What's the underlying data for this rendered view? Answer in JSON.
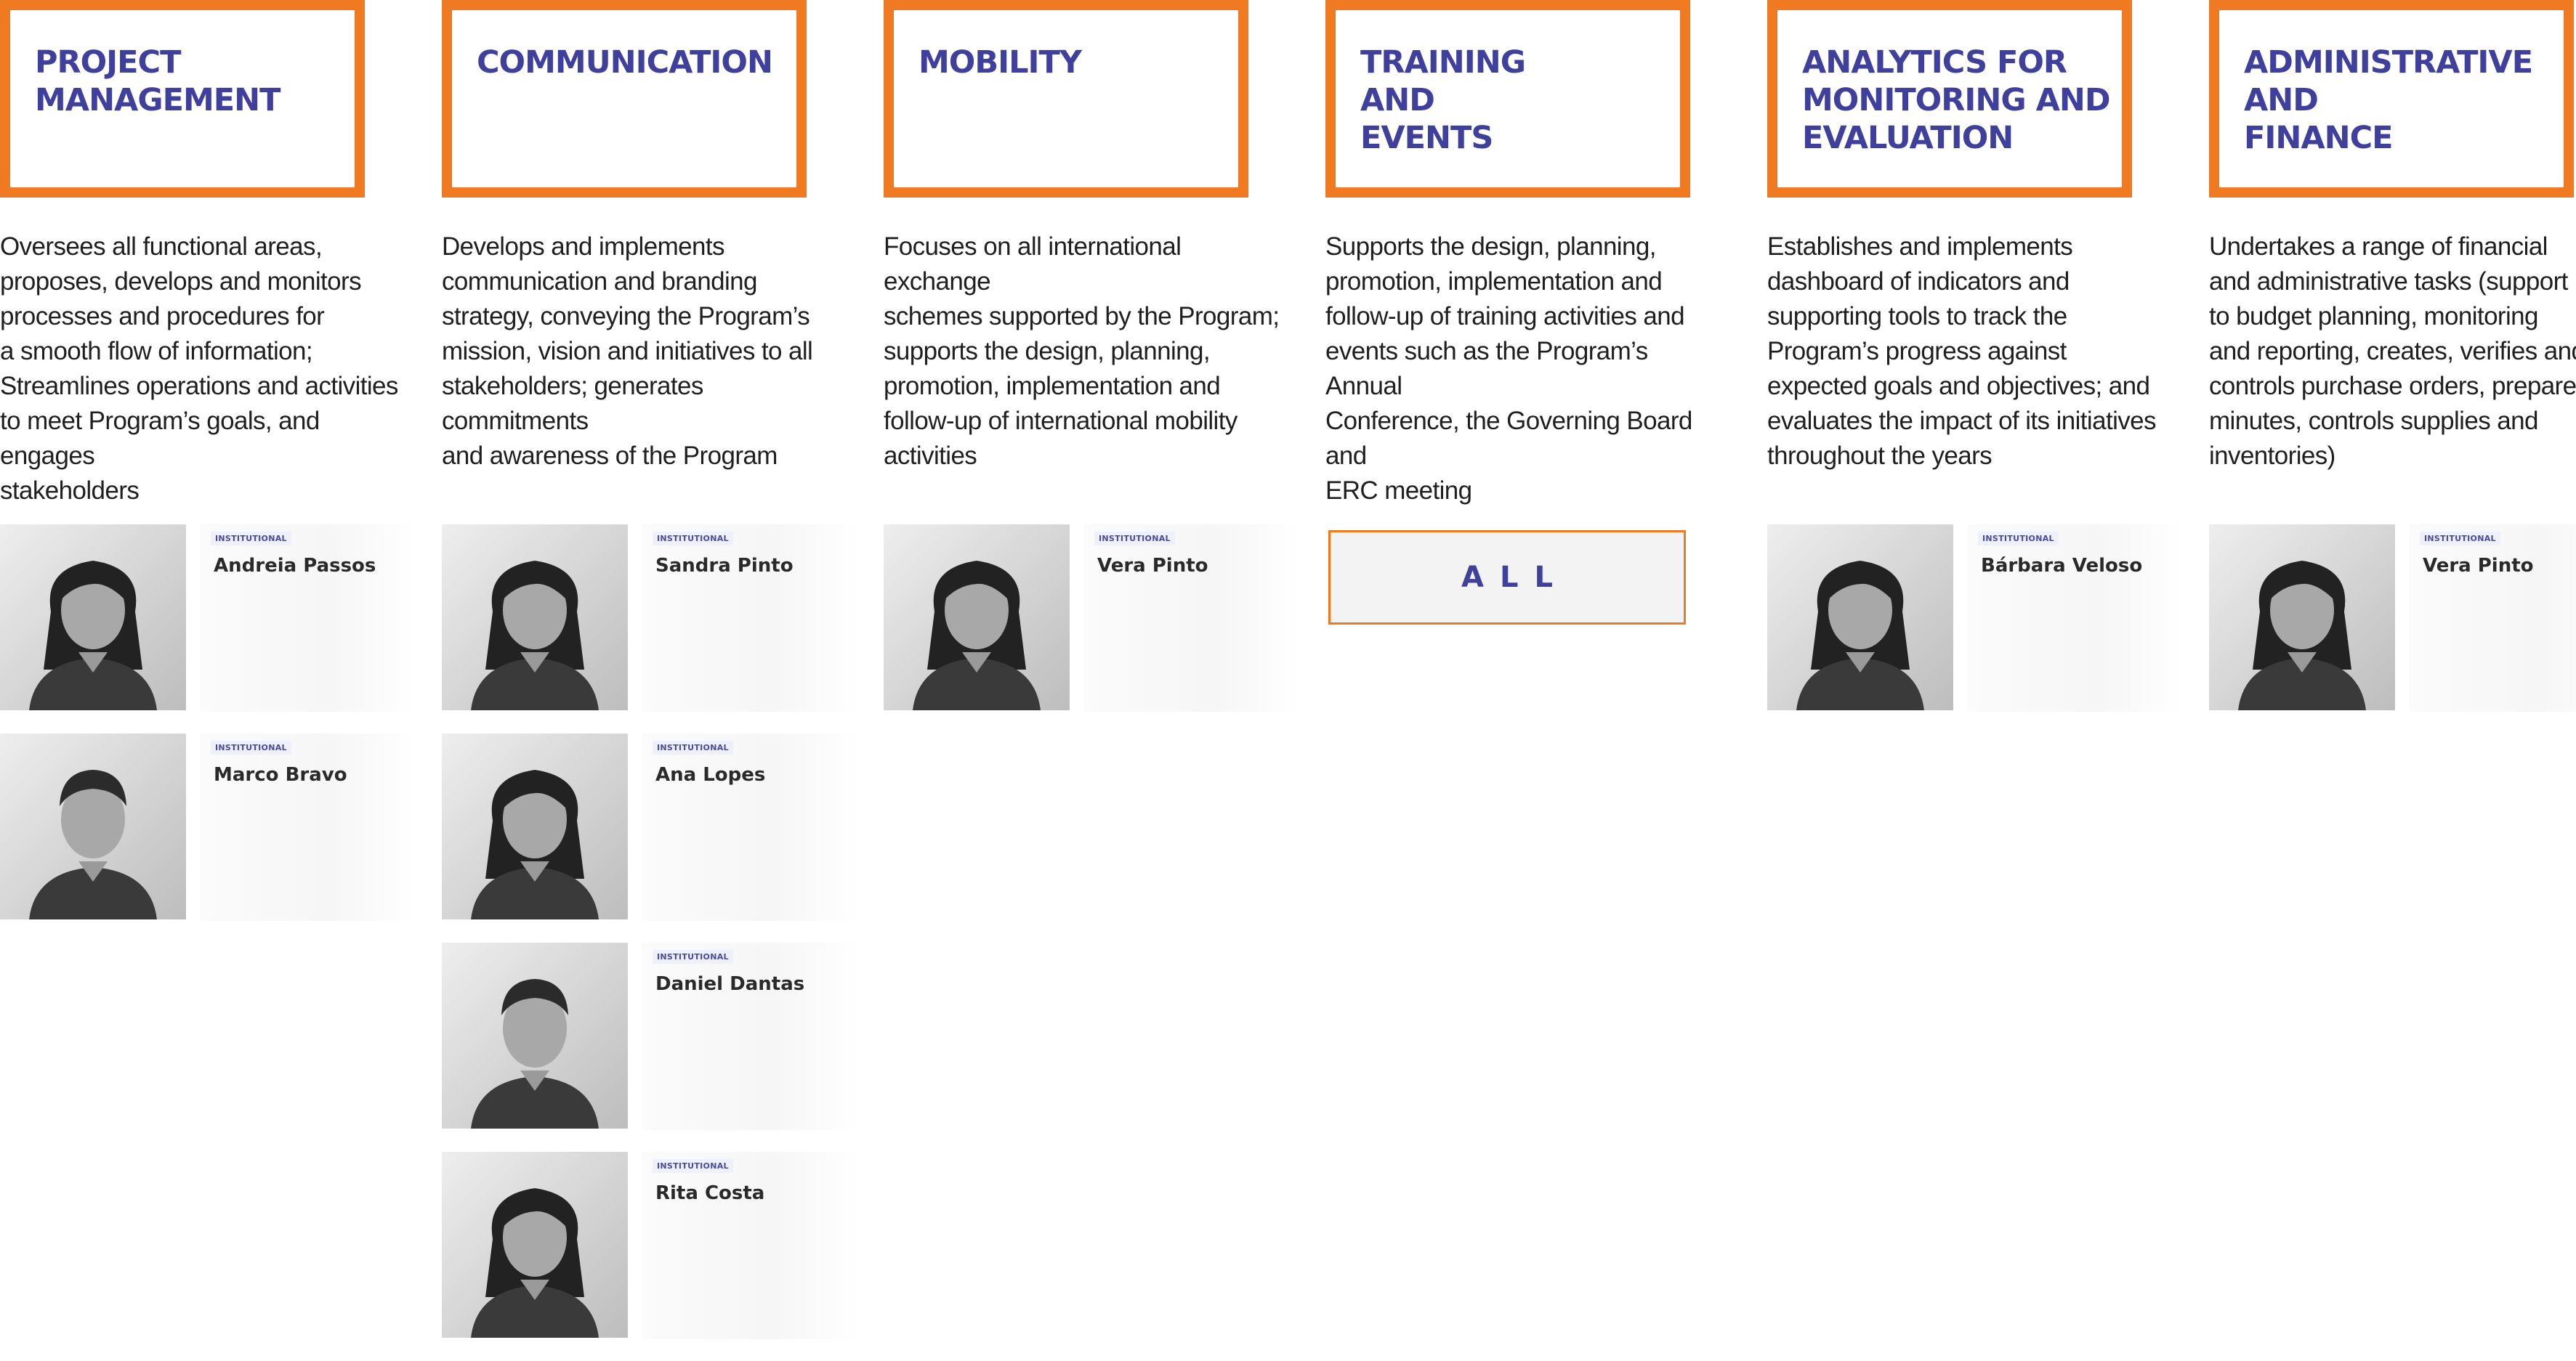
{
  "areas": [
    {
      "title": "PROJECT\nMANAGEMENT",
      "description": "Oversees all functional areas, proposes, develops and monitors processes and procedures for a smooth flow of information; Streamlines operations and activities to meet Program’s goals, and engages stakeholders",
      "members": [
        {
          "tag": "INSTITUTIONAL",
          "name": "Andreia Passos",
          "photo_icon": "portrait-woman"
        },
        {
          "tag": "INSTITUTIONAL",
          "name": "Marco Bravo",
          "photo_icon": "portrait-man"
        }
      ]
    },
    {
      "title": "COMMUNICATION",
      "description": "Develops and implements communication and branding strategy, conveying the Program’s mission, vision and initiatives to all stakeholders; generates commitments and awareness of the Program",
      "members": [
        {
          "tag": "INSTITUTIONAL",
          "name": "Sandra Pinto",
          "photo_icon": "portrait-woman"
        },
        {
          "tag": "INSTITUTIONAL",
          "name": "Ana Lopes",
          "photo_icon": "portrait-woman"
        },
        {
          "tag": "INSTITUTIONAL",
          "name": "Daniel Dantas",
          "photo_icon": "portrait-man"
        },
        {
          "tag": "INSTITUTIONAL",
          "name": "Rita Costa",
          "photo_icon": "portrait-woman"
        }
      ]
    },
    {
      "title": "MOBILITY",
      "description": "Focuses on all international exchange schemes supported by the Program; supports the design, planning, promotion, implementation and follow-up of international mobility activities",
      "members": [
        {
          "tag": "INSTITUTIONAL",
          "name": "Vera Pinto",
          "photo_icon": "portrait-woman"
        }
      ]
    },
    {
      "title": "TRAINING\nAND\nEVENTS",
      "description": "Supports the design, planning, promotion, implementation and follow-up of training activities and events such as the Program’s Annual Conference, the Governing Board and ERC meeting",
      "members": [],
      "all_button": "ALL"
    },
    {
      "title": "ANALYTICS FOR\nMONITORING AND\nEVALUATION",
      "description": "Establishes and implements dashboard of indicators and supporting tools to track the Program’s progress against expected goals and objectives; and evaluates the impact of its initiatives throughout the years",
      "members": [
        {
          "tag": "INSTITUTIONAL",
          "name": "Bárbara Veloso",
          "photo_icon": "portrait-woman"
        }
      ]
    },
    {
      "title": "ADMINISTRATIVE\nAND\nFINANCE",
      "description": "Undertakes a range of financial and administrative tasks (support to budget planning, monitoring and reporting, creates, verifies and controls purchase orders, prepares minutes, controls supplies and inventories)",
      "members": [
        {
          "tag": "INSTITUTIONAL",
          "name": "Vera Pinto",
          "photo_icon": "portrait-woman"
        }
      ]
    }
  ],
  "colors": {
    "accent_orange": "#f07a22",
    "title_blue": "#3f3f9e"
  }
}
